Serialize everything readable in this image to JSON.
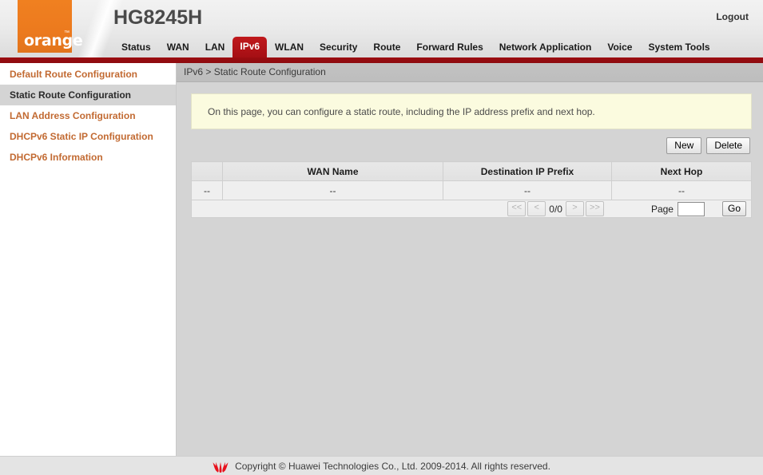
{
  "header": {
    "brand_logo_text": "orange",
    "brand_tm": "™",
    "product_title": "HG8245H",
    "logout_label": "Logout",
    "accent_red": "#b41318",
    "accent_orange": "#ec7a1e"
  },
  "nav": {
    "items": [
      {
        "label": "Status",
        "active": false
      },
      {
        "label": "WAN",
        "active": false
      },
      {
        "label": "LAN",
        "active": false
      },
      {
        "label": "IPv6",
        "active": true
      },
      {
        "label": "WLAN",
        "active": false
      },
      {
        "label": "Security",
        "active": false
      },
      {
        "label": "Route",
        "active": false
      },
      {
        "label": "Forward Rules",
        "active": false
      },
      {
        "label": "Network Application",
        "active": false
      },
      {
        "label": "Voice",
        "active": false
      },
      {
        "label": "System Tools",
        "active": false
      }
    ]
  },
  "sidebar": {
    "items": [
      {
        "label": "Default Route Configuration",
        "active": false
      },
      {
        "label": "Static Route Configuration",
        "active": true
      },
      {
        "label": "LAN Address Configuration",
        "active": false
      },
      {
        "label": "DHCPv6 Static IP Configuration",
        "active": false
      },
      {
        "label": "DHCPv6 Information",
        "active": false
      }
    ]
  },
  "main": {
    "breadcrumb": "IPv6 > Static Route Configuration",
    "info_text": "On this page, you can configure a static route, including the IP address prefix and next hop.",
    "new_label": "New",
    "delete_label": "Delete",
    "table": {
      "headers": [
        "",
        "WAN Name",
        "Destination IP Prefix",
        "Next Hop"
      ],
      "rows": [
        [
          "--",
          "--",
          "--",
          "--"
        ]
      ]
    },
    "pager": {
      "first_label": "<<",
      "prev_label": "<",
      "count_label": "0/0",
      "next_label": ">",
      "last_label": ">>",
      "page_label": "Page",
      "page_value": "",
      "page_placeholder": "",
      "go_label": "Go"
    }
  },
  "footer": {
    "logo_name": "huawei-flower-logo",
    "copyright": "Copyright © Huawei Technologies Co., Ltd. 2009-2014. All rights reserved."
  }
}
